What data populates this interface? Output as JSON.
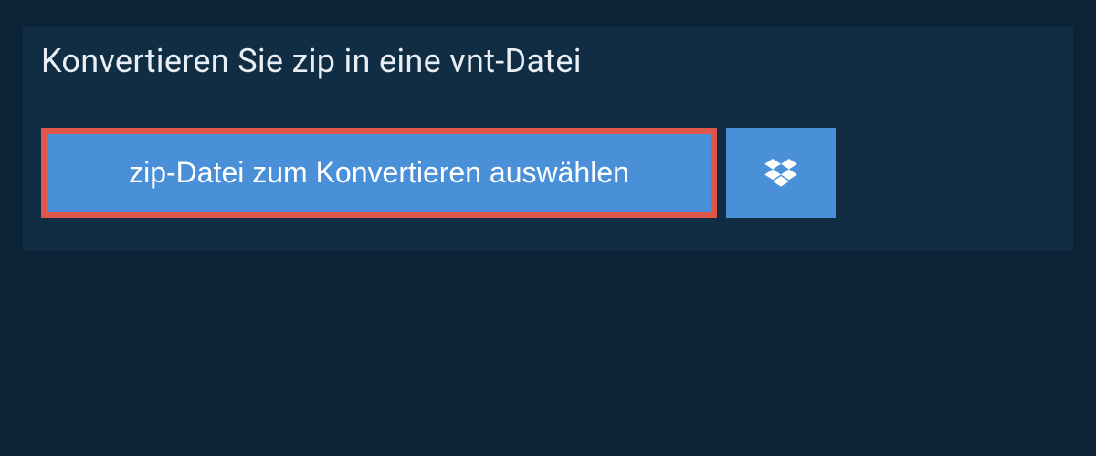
{
  "header": {
    "title": "Konvertieren Sie zip in eine vnt-Datei"
  },
  "actions": {
    "select_file_label": "zip-Datei zum Konvertieren auswählen"
  },
  "colors": {
    "page_bg": "#0d2438",
    "panel_bg": "#112d44",
    "button_bg": "#4a90d9",
    "button_highlight_border": "#e1564b",
    "text_light": "#ffffff"
  }
}
